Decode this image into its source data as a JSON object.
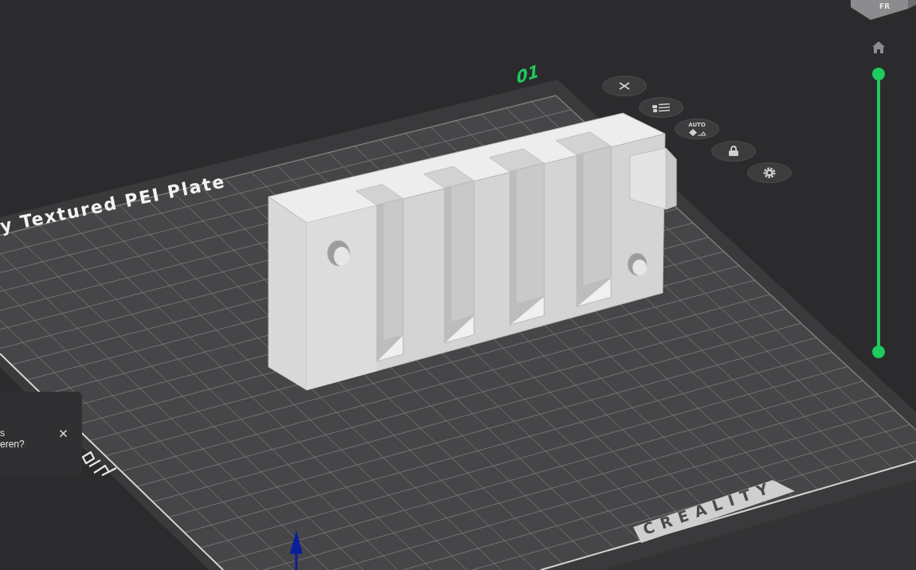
{
  "plate": {
    "name": "y Textured PEI Plate",
    "number": "01",
    "brand": "CREALITY"
  },
  "plate_buttons": [
    {
      "kind": "close"
    },
    {
      "kind": "list"
    },
    {
      "kind": "arrange",
      "label": "AUTO"
    },
    {
      "kind": "lock"
    },
    {
      "kind": "settings"
    }
  ],
  "view_cube": {
    "face_label": "FR"
  },
  "layer_slider": {
    "handles": [
      {
        "level": 1
      },
      {
        "level": 0
      }
    ]
  },
  "notification": {
    "message_lines": [
      "s",
      "eren?"
    ]
  }
}
